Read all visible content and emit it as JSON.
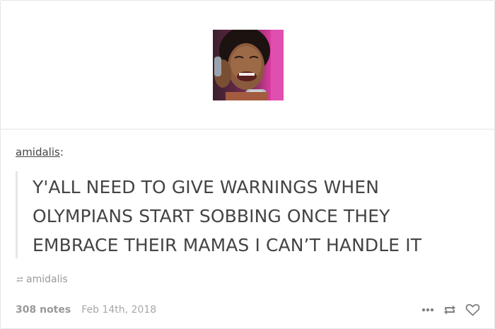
{
  "post": {
    "author": "amidalis",
    "author_suffix": ":",
    "quote": "Y'ALL NEED TO GIVE WARNINGS WHEN OLYMPIANS START SOBBING ONCE THEY EMBRACE THEIR MAMAS I CAN’T HANDLE IT",
    "reblog_source": "amidalis",
    "notes": "308 notes",
    "date": "Feb 14th, 2018"
  },
  "icons": {
    "reblog_source": "reblog-icon",
    "more": "more-dots-icon",
    "reblog": "reblog-icon",
    "like": "heart-icon"
  },
  "colors": {
    "text": "#444444",
    "muted": "#999999",
    "border": "#e6e6e6",
    "icon": "#808080"
  }
}
